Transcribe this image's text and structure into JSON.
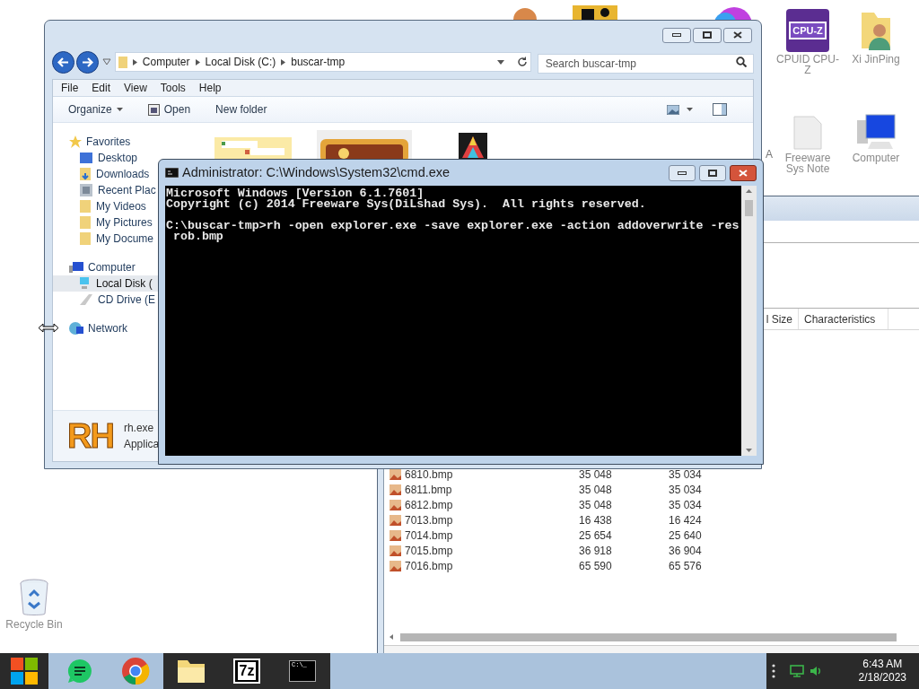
{
  "desktop_icons": [
    {
      "kind": "cpuz",
      "icon_text": "CPU-Z",
      "label": "CPUID CPU-Z"
    },
    {
      "kind": "user-folder",
      "label": "Xi JinPing"
    },
    {
      "kind": "document",
      "label": "Freeware Sys Note"
    },
    {
      "kind": "computer",
      "label": "Computer"
    },
    {
      "kind": "recycle-bin",
      "label": "Recycle Bin"
    }
  ],
  "cut_label": "A",
  "file_window": {
    "columns": [
      {
        "label": "l Size"
      },
      {
        "label": "Characteristics"
      }
    ],
    "rows": [
      {
        "name": "6810.bmp",
        "column_2": "35 048",
        "column_3": "35 034"
      },
      {
        "name": "6811.bmp",
        "column_2": "35 048",
        "column_3": "35 034"
      },
      {
        "name": "6812.bmp",
        "column_2": "35 048",
        "column_3": "35 034"
      },
      {
        "name": "7013.bmp",
        "column_2": "16 438",
        "column_3": "16 424"
      },
      {
        "name": "7014.bmp",
        "column_2": "25 654",
        "column_3": "25 640"
      },
      {
        "name": "7015.bmp",
        "column_2": "36 918",
        "column_3": "36 904"
      },
      {
        "name": "7016.bmp",
        "column_2": "65 590",
        "column_3": "65 576"
      }
    ]
  },
  "explorer": {
    "breadcrumb": [
      "Computer",
      "Local Disk (C:)",
      "buscar-tmp"
    ],
    "search": {
      "placeholder": "Search buscar-tmp"
    },
    "menu": [
      "File",
      "Edit",
      "View",
      "Tools",
      "Help"
    ],
    "toolbar": [
      {
        "kind": "dropdown",
        "label": "Organize"
      },
      {
        "kind": "open",
        "label": "Open"
      },
      {
        "kind": "plain",
        "label": "New folder"
      }
    ],
    "nav": [
      {
        "kind": "favorites",
        "label": "Favorites",
        "children": [
          {
            "kind": "desktop",
            "label": "Desktop",
            "selected": false
          },
          {
            "kind": "downloads",
            "label": "Downloads",
            "selected": false
          },
          {
            "kind": "recent",
            "label": "Recent Plac",
            "selected": false
          },
          {
            "kind": "folder",
            "label": "My Videos",
            "selected": false
          },
          {
            "kind": "folder",
            "label": "My Pictures",
            "selected": false
          },
          {
            "kind": "folder",
            "label": "My Docume",
            "selected": false
          }
        ]
      },
      {
        "kind": "computer",
        "label": "Computer",
        "children": [
          {
            "kind": "disk",
            "label": "Local Disk (",
            "selected": true
          },
          {
            "kind": "cd",
            "label": "CD Drive (E",
            "selected": false
          }
        ]
      },
      {
        "kind": "network",
        "label": "Network"
      }
    ],
    "details": {
      "logo_text": "RH",
      "name": "rh.exe",
      "type": "Applica"
    }
  },
  "cmd": {
    "title": "Administrator: C:\\Windows\\System32\\cmd.exe",
    "blocks": [
      [
        "Microsoft Windows [Version 6.1.7601]",
        "Copyright (c) 2014 Freeware Sys(DiLshad Sys).  All rights reserved."
      ],
      [
        "C:\\buscar-tmp>rh -open explorer.exe -save explorer.exe -action addoverwrite -res",
        " rob.bmp"
      ]
    ]
  },
  "taskbar": {
    "apps": [
      {
        "kind": "chat",
        "running": false
      },
      {
        "kind": "chrome",
        "running": false
      },
      {
        "kind": "folder",
        "running": true
      },
      {
        "kind": "archive",
        "label": "7z",
        "running": true
      },
      {
        "kind": "terminal",
        "label": "C:\\_",
        "running": true
      }
    ],
    "time": "6:43 AM",
    "date": "2/18/2023"
  }
}
